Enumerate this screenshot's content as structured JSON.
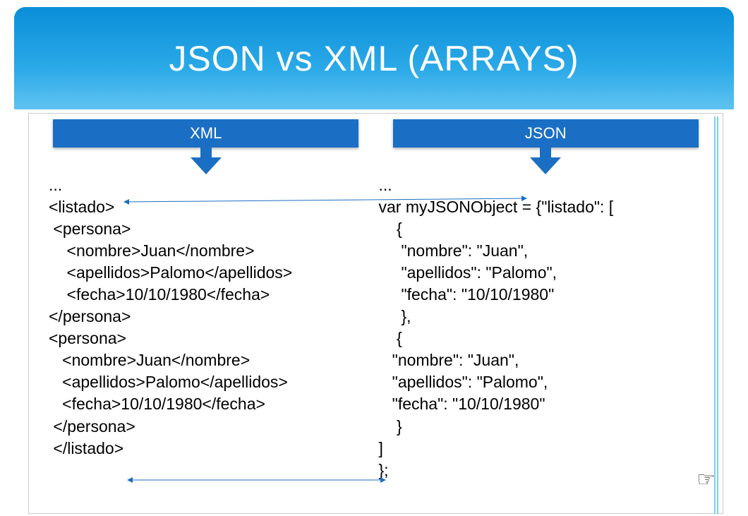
{
  "title": "JSON vs XML (ARRAYS)",
  "left": {
    "heading": "XML",
    "code": "...\n<listado>\n <persona>\n    <nombre>Juan</nombre>\n    <apellidos>Palomo</apellidos>\n    <fecha>10/10/1980</fecha>\n</persona>\n<persona>\n   <nombre>Juan</nombre>\n   <apellidos>Palomo</apellidos>\n   <fecha>10/10/1980</fecha>\n </persona>\n </listado>"
  },
  "right": {
    "heading": "JSON",
    "code": "...\nvar myJSONObject = {\"listado\": [\n    {\n     \"nombre\": \"Juan\",\n     \"apellidos\": \"Palomo\",\n     \"fecha\": \"10/10/1980\"\n     },\n    {\n   \"nombre\": \"Juan\",\n   \"apellidos\": \"Palomo\",\n   \"fecha\": \"10/10/1980\"\n    }\n]\n};"
  },
  "hand_icon": "☞"
}
